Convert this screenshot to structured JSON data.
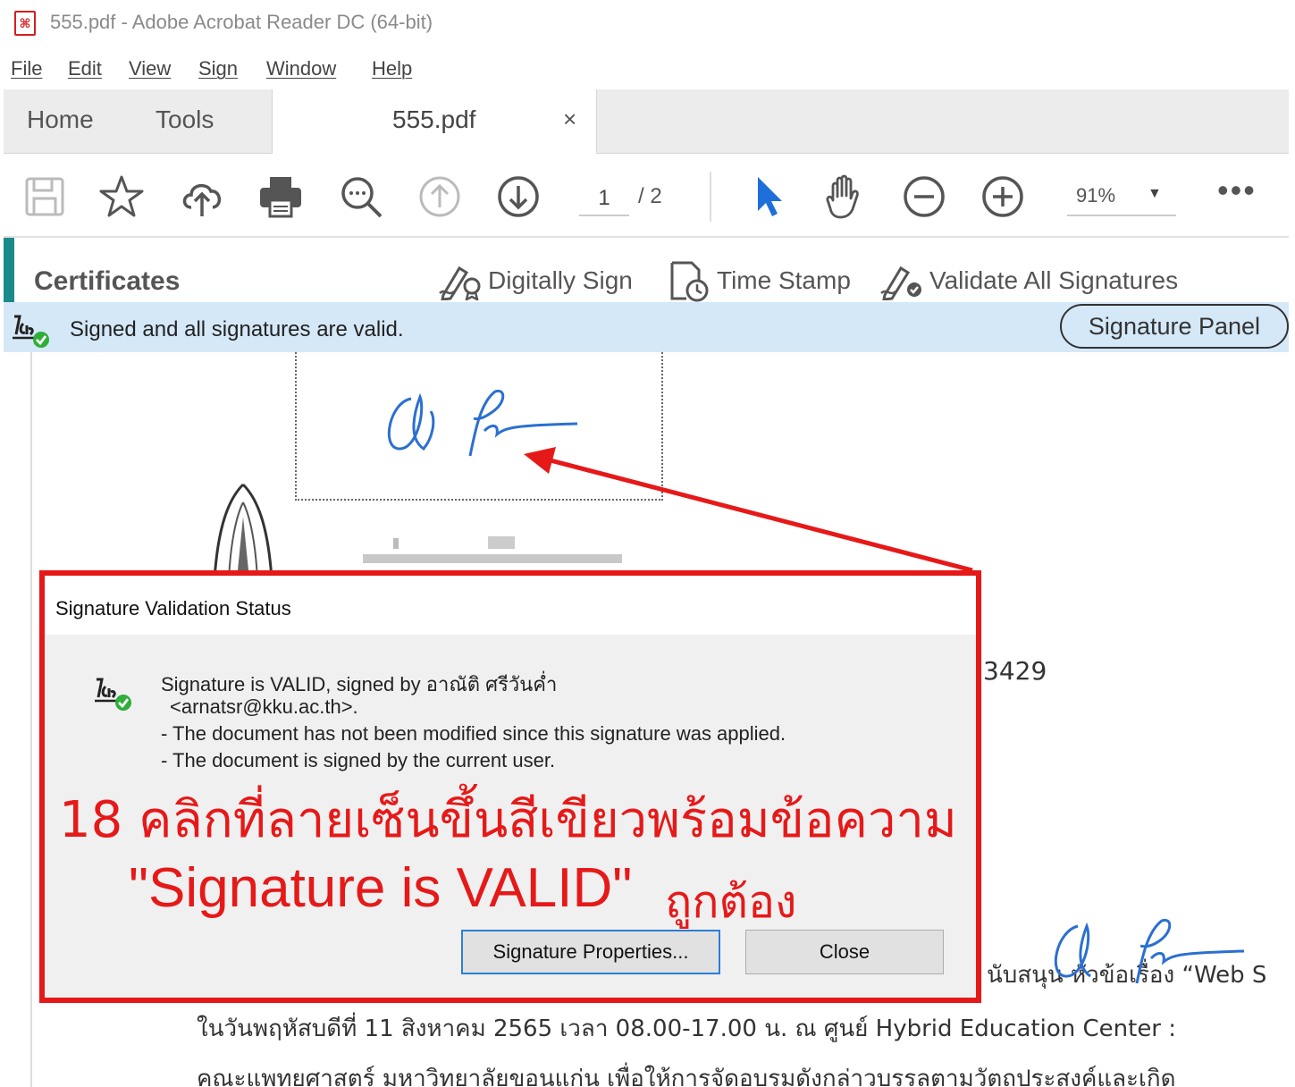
{
  "window": {
    "title": "555.pdf - Adobe Acrobat Reader DC (64-bit)",
    "app_icon": "pdf-icon"
  },
  "menu": [
    "File",
    "Edit",
    "View",
    "Sign",
    "Window",
    "Help"
  ],
  "tabs": {
    "home": "Home",
    "tools": "Tools",
    "document": "555.pdf",
    "close_glyph": "×"
  },
  "toolbar": {
    "icons": [
      "save-icon",
      "star-icon",
      "upload-icon",
      "print-icon",
      "find-icon",
      "page-up-icon",
      "page-down-icon",
      "select-arrow-icon",
      "hand-icon",
      "zoom-out-icon",
      "zoom-in-icon"
    ],
    "current_page": "1",
    "page_total": "/ 2",
    "zoom": "91%",
    "more_glyph": "•••"
  },
  "certificates": {
    "title": "Certificates",
    "digitally_sign": "Digitally Sign",
    "time_stamp": "Time Stamp",
    "validate_all": "Validate All Signatures"
  },
  "signature_bar": {
    "message": "Signed and all signatures are valid.",
    "panel_button": "Signature Panel"
  },
  "document": {
    "number_fragment": "3429",
    "line_1a": "นับสนุน หัวข้อเรื่อง “Web S",
    "line_2": "ในวันพฤหัสบดีที่ 11 สิงหาคม 2565 เวลา 08.00-17.00 น.  ณ ศูนย์ Hybrid Education Center :",
    "line_3": "คณะแพทยศาสตร์ มหาวิทยาลัยขอนแก่น   เพื่อให้การจัดอบรมดังกล่าวบรรลุตามวัตถุประสงค์และเกิด"
  },
  "dialog": {
    "title": "Signature Validation Status",
    "line_1": "Signature is VALID, signed by อาณัติ ศรีวันค่ำ",
    "line_2": "<arnatsr@kku.ac.th>.",
    "line_3": "- The document has not been modified since this signature was applied.",
    "line_4": "- The document is signed by the current user.",
    "properties_button": "Signature Properties...",
    "close_button": "Close"
  },
  "annotation": {
    "line_1": "18 คลิกที่ลายเซ็นขึ้นสีเขียวพร้อมข้อความ",
    "line_2a": "\"Signature is VALID\"",
    "line_2b": "ถูกต้อง",
    "color": "#e61919"
  },
  "colors": {
    "accent_teal": "#1b8a8a",
    "signature_bar_bg": "#d5e8f8",
    "signature_ink": "#2b6fd1",
    "valid_green": "#2fae3a"
  }
}
